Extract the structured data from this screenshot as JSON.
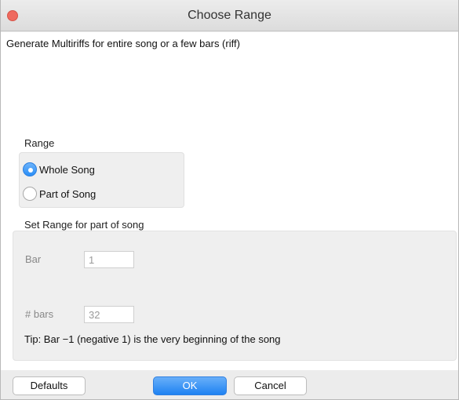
{
  "window": {
    "title": "Choose Range"
  },
  "description": "Generate Multiriffs for entire song or a few bars (riff)",
  "range": {
    "label": "Range",
    "options": [
      {
        "label": "Whole Song",
        "checked": true
      },
      {
        "label": "Part of Song",
        "checked": false
      }
    ]
  },
  "part_range": {
    "label": "Set Range for part of song",
    "bar_label": "Bar",
    "bar_value": "1",
    "num_bars_label": "# bars",
    "num_bars_value": "32",
    "tip": "Tip: Bar −1 (negative 1) is the very beginning of the song"
  },
  "buttons": {
    "defaults": "Defaults",
    "ok": "OK",
    "cancel": "Cancel"
  },
  "colors": {
    "accent": "#2a8ef7",
    "close": "#ef6a5f"
  }
}
